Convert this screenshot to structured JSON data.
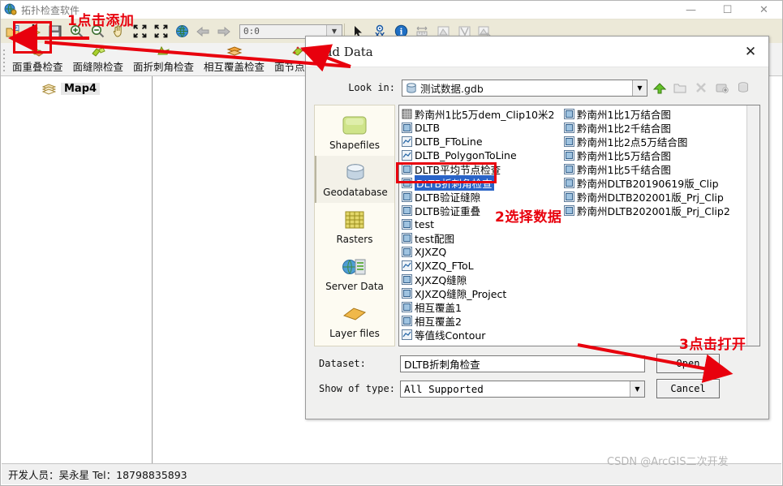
{
  "window": {
    "title": "拓扑检查软件",
    "icon": "globe-icon",
    "minimize": "—",
    "maximize": "☐",
    "close": "✕"
  },
  "toolbar": {
    "buttons": [
      {
        "name": "open-folder-icon",
        "tip": "打开"
      },
      {
        "name": "add-data-icon",
        "tip": "添加数据"
      },
      {
        "name": "save-icon",
        "tip": "保存"
      },
      {
        "name": "zoom-in-icon",
        "tip": "放大"
      },
      {
        "name": "zoom-out-icon",
        "tip": "缩小"
      },
      {
        "name": "pan-hand-icon",
        "tip": "平移"
      },
      {
        "name": "zoom-to-selection-icon",
        "tip": "缩小至选择"
      },
      {
        "name": "full-extent-icon",
        "tip": "全图"
      },
      {
        "name": "globe-extent-icon",
        "tip": "全局范围"
      },
      {
        "name": "back-arrow-icon",
        "tip": "后退"
      },
      {
        "name": "forward-arrow-icon",
        "tip": "前进"
      }
    ],
    "coordinate_value": "0:0",
    "tools": [
      {
        "name": "select-arrow-icon"
      },
      {
        "name": "xy-point-icon"
      },
      {
        "name": "identify-info-icon"
      },
      {
        "name": "measure-icon"
      },
      {
        "name": "clip-icon"
      },
      {
        "name": "split-icon"
      },
      {
        "name": "export-icon"
      }
    ]
  },
  "tabs": [
    {
      "label": "面重叠检查",
      "icon": "overlap-check-icon"
    },
    {
      "label": "面缝隙检查",
      "icon": "gap-check-icon"
    },
    {
      "label": "面折刺角检查",
      "icon": "spike-check-icon"
    },
    {
      "label": "相互覆盖检查",
      "icon": "mutual-cover-check-icon"
    },
    {
      "label": "面节点密度",
      "icon": "node-density-check-icon"
    }
  ],
  "toc": {
    "items": [
      {
        "label": "Map4",
        "icon": "layers-icon"
      }
    ]
  },
  "statusbar": {
    "text": "开发人员：吴永星 Tel：18798835893"
  },
  "watermark": "CSDN @ArcGIS二次开发",
  "dialog": {
    "title": "Add Data",
    "close_label": "✕",
    "lookin": {
      "label": "Look in:",
      "value": "测试数据.gdb",
      "icon": "geodatabase-icon",
      "arrow": "▼"
    },
    "nav_buttons": [
      {
        "name": "up-one-level-icon"
      },
      {
        "name": "new-folder-icon"
      },
      {
        "name": "delete-connection-icon"
      },
      {
        "name": "connect-to-folder-icon"
      },
      {
        "name": "connect-to-database-icon"
      }
    ],
    "places": [
      {
        "label": "Shapefiles",
        "icon": "shapefile-icon",
        "selected": false
      },
      {
        "label": "Geodatabase",
        "icon": "geodatabase-icon",
        "selected": true
      },
      {
        "label": "Rasters",
        "icon": "raster-icon",
        "selected": false
      },
      {
        "label": "Server Data",
        "icon": "server-data-icon",
        "selected": false
      },
      {
        "label": "Layer files",
        "icon": "layer-file-icon",
        "selected": false
      }
    ],
    "file_columns": [
      [
        {
          "name": "黔南州1比5万dem_Clip10米2",
          "icon": "raster-icon",
          "selected": false
        },
        {
          "name": "DLTB",
          "icon": "polygon-feature-icon",
          "selected": false
        },
        {
          "name": "DLTB_FToLine",
          "icon": "line-feature-icon",
          "selected": false
        },
        {
          "name": "DLTB_PolygonToLine",
          "icon": "line-feature-icon",
          "selected": false
        },
        {
          "name": "DLTB平均节点检查",
          "icon": "polygon-feature-icon",
          "selected": false
        },
        {
          "name": "DLTB折刺角检查",
          "icon": "polygon-feature-icon",
          "selected": true
        },
        {
          "name": "DLTB验证缝隙",
          "icon": "polygon-feature-icon",
          "selected": false
        },
        {
          "name": "DLTB验证重叠",
          "icon": "polygon-feature-icon",
          "selected": false
        },
        {
          "name": "test",
          "icon": "polygon-feature-icon",
          "selected": false
        },
        {
          "name": "test配图",
          "icon": "polygon-feature-icon",
          "selected": false
        },
        {
          "name": "XJXZQ",
          "icon": "polygon-feature-icon",
          "selected": false
        },
        {
          "name": "XJXZQ_FToL",
          "icon": "line-feature-icon",
          "selected": false
        },
        {
          "name": "XJXZQ缝隙",
          "icon": "polygon-feature-icon",
          "selected": false
        },
        {
          "name": "XJXZQ缝隙_Project",
          "icon": "polygon-feature-icon",
          "selected": false
        },
        {
          "name": "相互覆盖1",
          "icon": "polygon-feature-icon",
          "selected": false
        },
        {
          "name": "相互覆盖2",
          "icon": "polygon-feature-icon",
          "selected": false
        },
        {
          "name": "等值线Contour",
          "icon": "line-feature-icon",
          "selected": false
        }
      ],
      [
        {
          "name": "黔南州1比1万结合图",
          "icon": "polygon-feature-icon",
          "selected": false
        },
        {
          "name": "黔南州1比2千结合图",
          "icon": "polygon-feature-icon",
          "selected": false
        },
        {
          "name": "黔南州1比2点5万结合图",
          "icon": "polygon-feature-icon",
          "selected": false
        },
        {
          "name": "黔南州1比5万结合图",
          "icon": "polygon-feature-icon",
          "selected": false
        },
        {
          "name": "黔南州1比5千结合图",
          "icon": "polygon-feature-icon",
          "selected": false
        },
        {
          "name": "黔南州DLTB20190619版_Clip",
          "icon": "polygon-feature-icon",
          "selected": false
        },
        {
          "name": "黔南州DLTB202001版_Prj_Clip",
          "icon": "polygon-feature-icon",
          "selected": false
        },
        {
          "name": "黔南州DLTB202001版_Prj_Clip2",
          "icon": "polygon-feature-icon",
          "selected": false
        }
      ]
    ],
    "dataset": {
      "label": "Dataset:",
      "value": "DLTB折刺角检查"
    },
    "show_of_type": {
      "label": "Show of type:",
      "value": "All Supported",
      "arrow": "▼"
    },
    "open_button": "Open",
    "cancel_button": "Cancel"
  },
  "annotations": {
    "color": "#e8000d",
    "steps": [
      {
        "id": "step1",
        "text": "1点击添加"
      },
      {
        "id": "step2",
        "text": "2选择数据"
      },
      {
        "id": "step3",
        "text": "3点击打开"
      }
    ]
  }
}
